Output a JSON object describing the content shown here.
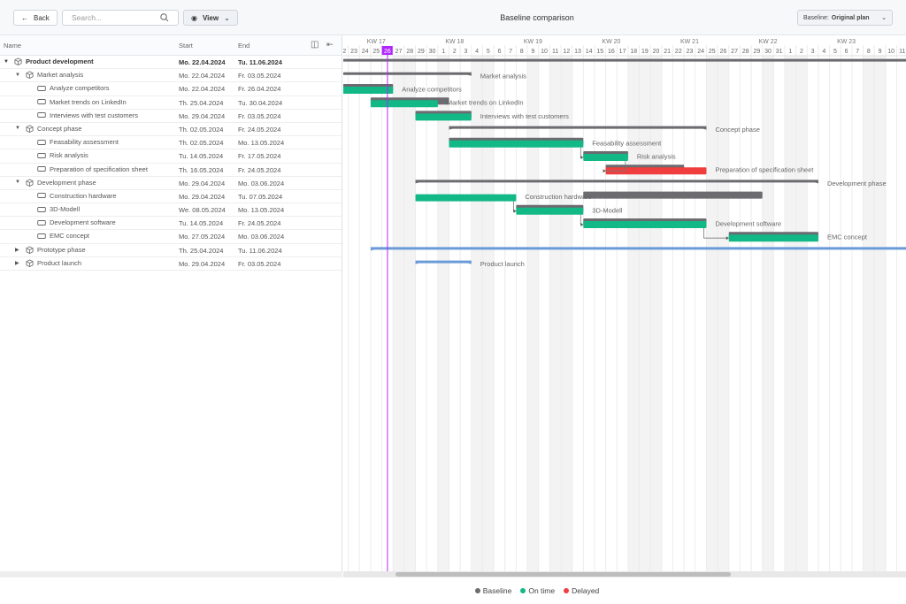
{
  "toolbar": {
    "back_label": "Back",
    "search_placeholder": "Search...",
    "view_label": "View",
    "title": "Baseline comparison",
    "baseline_label": "Baseline:",
    "baseline_value": "Original plan"
  },
  "tree": {
    "columns": {
      "name": "Name",
      "start": "Start",
      "end": "End"
    },
    "rows": [
      {
        "name": "Product development",
        "start": "Mo. 22.04.2024",
        "end": "Tu. 11.06.2024",
        "level": 0,
        "type": "group",
        "expanded": true,
        "bold": true
      },
      {
        "name": "Market analysis",
        "start": "Mo. 22.04.2024",
        "end": "Fr. 03.05.2024",
        "level": 1,
        "type": "group",
        "expanded": true
      },
      {
        "name": "Analyze competitors",
        "start": "Mo. 22.04.2024",
        "end": "Fr. 26.04.2024",
        "level": 2,
        "type": "task"
      },
      {
        "name": "Market trends on LinkedIn",
        "start": "Th. 25.04.2024",
        "end": "Tu. 30.04.2024",
        "level": 2,
        "type": "task"
      },
      {
        "name": "Interviews with test customers",
        "start": "Mo. 29.04.2024",
        "end": "Fr. 03.05.2024",
        "level": 2,
        "type": "task"
      },
      {
        "name": "Concept phase",
        "start": "Th. 02.05.2024",
        "end": "Fr. 24.05.2024",
        "level": 1,
        "type": "group",
        "expanded": true
      },
      {
        "name": "Feasability assessment",
        "start": "Th. 02.05.2024",
        "end": "Mo. 13.05.2024",
        "level": 2,
        "type": "task"
      },
      {
        "name": "Risk analysis",
        "start": "Tu. 14.05.2024",
        "end": "Fr. 17.05.2024",
        "level": 2,
        "type": "task"
      },
      {
        "name": "Preparation of specification sheet",
        "start": "Th. 16.05.2024",
        "end": "Fr. 24.05.2024",
        "level": 2,
        "type": "task"
      },
      {
        "name": "Development phase",
        "start": "Mo. 29.04.2024",
        "end": "Mo. 03.06.2024",
        "level": 1,
        "type": "group",
        "expanded": true
      },
      {
        "name": "Construction hardware",
        "start": "Mo. 29.04.2024",
        "end": "Tu. 07.05.2024",
        "level": 2,
        "type": "task"
      },
      {
        "name": "3D-Modell",
        "start": "We. 08.05.2024",
        "end": "Mo. 13.05.2024",
        "level": 2,
        "type": "task"
      },
      {
        "name": "Development software",
        "start": "Tu. 14.05.2024",
        "end": "Fr. 24.05.2024",
        "level": 2,
        "type": "task"
      },
      {
        "name": "EMC concept",
        "start": "Mo. 27.05.2024",
        "end": "Mo. 03.06.2024",
        "level": 2,
        "type": "task"
      },
      {
        "name": "Prototype phase",
        "start": "Th. 25.04.2024",
        "end": "Tu. 11.06.2024",
        "level": 1,
        "type": "group",
        "expanded": false
      },
      {
        "name": "Product launch",
        "start": "Mo. 29.04.2024",
        "end": "Fr. 03.05.2024",
        "level": 1,
        "type": "group",
        "expanded": false
      }
    ]
  },
  "timeline": {
    "first_day": "2024-04-22",
    "day_count": 52,
    "today": "2024-04-26",
    "weeks": [
      "KW 17",
      "KW 18",
      "KW 19",
      "KW 20",
      "KW 21",
      "KW 22",
      "KW 23"
    ],
    "holidays": [
      "2024-05-01",
      "2024-05-09",
      "2024-05-20",
      "2024-05-30"
    ]
  },
  "bars": [
    {
      "kind": "summary",
      "baseline": [
        "2024-04-22",
        "2024-06-12"
      ]
    },
    {
      "kind": "summary",
      "baseline": [
        "2024-04-22",
        "2024-05-03"
      ],
      "label": "Market analysis"
    },
    {
      "kind": "task",
      "baseline": [
        "2024-04-22",
        "2024-04-26"
      ],
      "actual": [
        "2024-04-22",
        "2024-04-26"
      ],
      "status": "on_time",
      "label": "Analyze competitors"
    },
    {
      "kind": "task",
      "baseline": [
        "2024-04-25",
        "2024-05-01"
      ],
      "actual": [
        "2024-04-25",
        "2024-04-30"
      ],
      "status": "on_time",
      "label": "Market trends on LinkedIn"
    },
    {
      "kind": "task",
      "baseline": [
        "2024-04-29",
        "2024-05-03"
      ],
      "actual": [
        "2024-04-29",
        "2024-05-03"
      ],
      "status": "on_time",
      "label": "Interviews with test customers"
    },
    {
      "kind": "summary",
      "baseline": [
        "2024-05-02",
        "2024-05-24"
      ],
      "label": "Concept phase"
    },
    {
      "kind": "task",
      "baseline": [
        "2024-05-02",
        "2024-05-13"
      ],
      "actual": [
        "2024-05-02",
        "2024-05-13"
      ],
      "status": "on_time",
      "label": "Feasability assessment"
    },
    {
      "kind": "task",
      "baseline": [
        "2024-05-14",
        "2024-05-17"
      ],
      "actual": [
        "2024-05-14",
        "2024-05-17"
      ],
      "status": "on_time",
      "label": "Risk analysis"
    },
    {
      "kind": "task",
      "baseline": [
        "2024-05-16",
        "2024-05-22"
      ],
      "actual": [
        "2024-05-16",
        "2024-05-24"
      ],
      "status": "delayed",
      "label": "Preparation of specification sheet"
    },
    {
      "kind": "summary",
      "baseline": [
        "2024-04-29",
        "2024-06-03"
      ],
      "label": "Development phase"
    },
    {
      "kind": "task",
      "baseline": [
        "2024-05-14",
        "2024-05-29"
      ],
      "actual": [
        "2024-04-29",
        "2024-05-07"
      ],
      "status": "on_time",
      "label": "Construction hardware"
    },
    {
      "kind": "task",
      "baseline": [
        "2024-05-08",
        "2024-05-13"
      ],
      "actual": [
        "2024-05-08",
        "2024-05-13"
      ],
      "status": "on_time",
      "label": "3D-Modell"
    },
    {
      "kind": "task",
      "baseline": [
        "2024-05-14",
        "2024-05-24"
      ],
      "actual": [
        "2024-05-14",
        "2024-05-24"
      ],
      "status": "on_time",
      "label": "Development software"
    },
    {
      "kind": "task",
      "baseline": [
        "2024-05-27",
        "2024-06-03"
      ],
      "actual": [
        "2024-05-27",
        "2024-06-03"
      ],
      "status": "on_time",
      "label": "EMC concept"
    },
    {
      "kind": "collapsed",
      "baseline": [
        "2024-04-25",
        "2024-06-12"
      ]
    },
    {
      "kind": "collapsed",
      "baseline": [
        "2024-04-29",
        "2024-05-03"
      ],
      "label": "Product launch"
    }
  ],
  "dependencies": [
    [
      6,
      7
    ],
    [
      7,
      8
    ],
    [
      10,
      11
    ],
    [
      11,
      12
    ],
    [
      12,
      13
    ]
  ],
  "legend": [
    {
      "label": "Baseline",
      "color": "#6b6b70"
    },
    {
      "label": "On time",
      "color": "#12b886"
    },
    {
      "label": "Delayed",
      "color": "#f03e3e"
    }
  ],
  "colors": {
    "baseline": "#6b6b70",
    "on_time": "#12b886",
    "delayed": "#f03e3e",
    "summary": "#6b6b70",
    "collapsed": "#6a9bd8",
    "today": "#b026ff"
  }
}
